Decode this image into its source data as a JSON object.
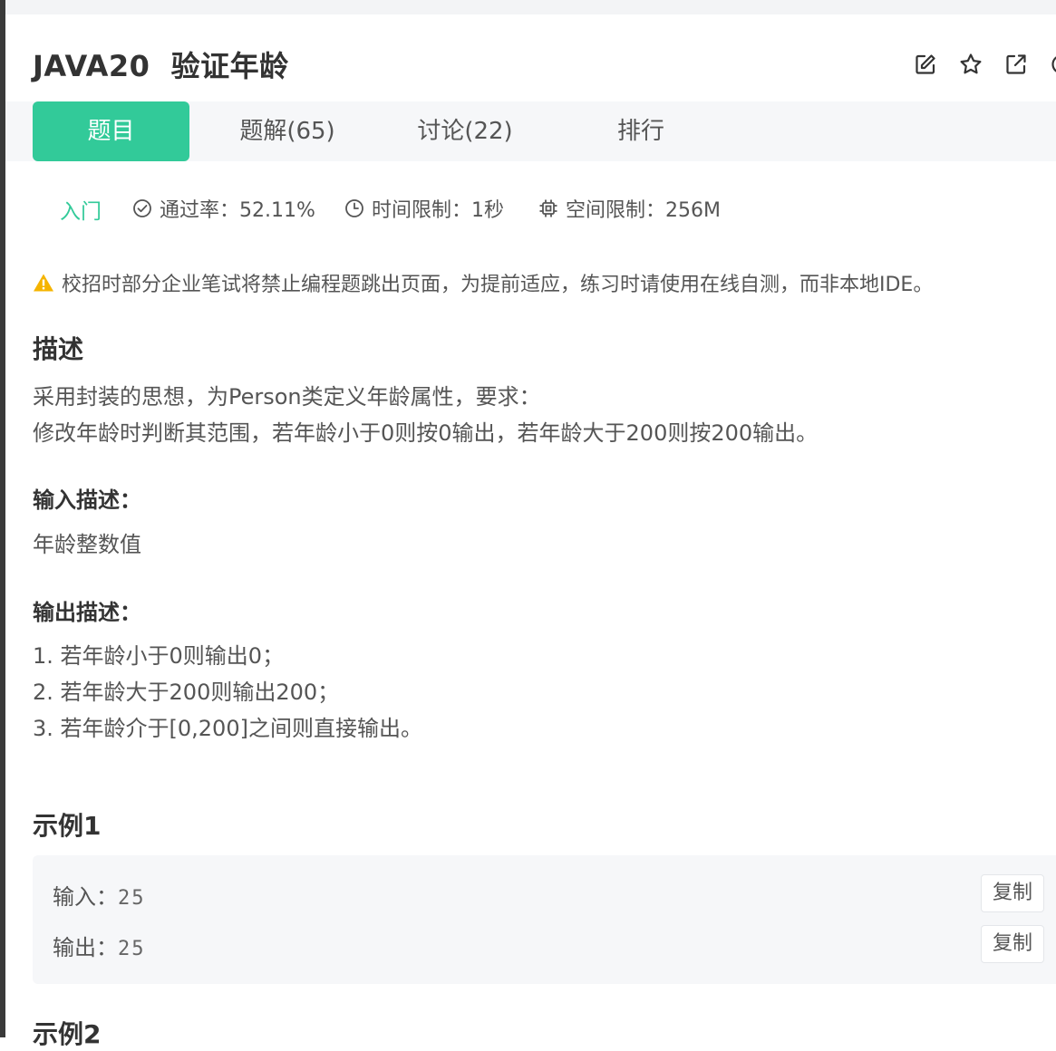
{
  "problem": {
    "title": "JAVA20  验证年龄"
  },
  "tabs": [
    {
      "label": "题目",
      "active": true
    },
    {
      "label": "题解(65)"
    },
    {
      "label": "讨论(22)"
    },
    {
      "label": "排行"
    }
  ],
  "meta": {
    "level": "入门",
    "pass_rate": "通过率：52.11%",
    "time_limit": "时间限制：1秒",
    "space_limit": "空间限制：256M"
  },
  "warning": "校招时部分企业笔试将禁止编程题跳出页面，为提前适应，练习时请使用在线自测，而非本地IDE。",
  "description": {
    "heading": "描述",
    "lines": [
      "采用封装的思想，为Person类定义年龄属性，要求：",
      "修改年龄时判断其范围，若年龄小于0则按0输出，若年龄大于200则按200输出。"
    ]
  },
  "input_desc": {
    "heading": "输入描述：",
    "text": "年龄整数值"
  },
  "output_desc": {
    "heading": "输出描述：",
    "lines": [
      "1. 若年龄小于0则输出0；",
      "2. 若年龄大于200则输出200；",
      "3. 若年龄介于[0,200]之间则直接输出。"
    ]
  },
  "example1": {
    "heading": "示例1",
    "input_label": "输入：",
    "input_value": "25",
    "output_label": "输出：",
    "output_value": "25",
    "copy_label": "复制"
  },
  "example2": {
    "heading": "示例2"
  },
  "colors": {
    "accent": "#32ca99",
    "warning": "#f5b400",
    "text": "#333333"
  },
  "icons": {
    "header": [
      "edit-icon",
      "star-icon",
      "share-icon"
    ]
  }
}
